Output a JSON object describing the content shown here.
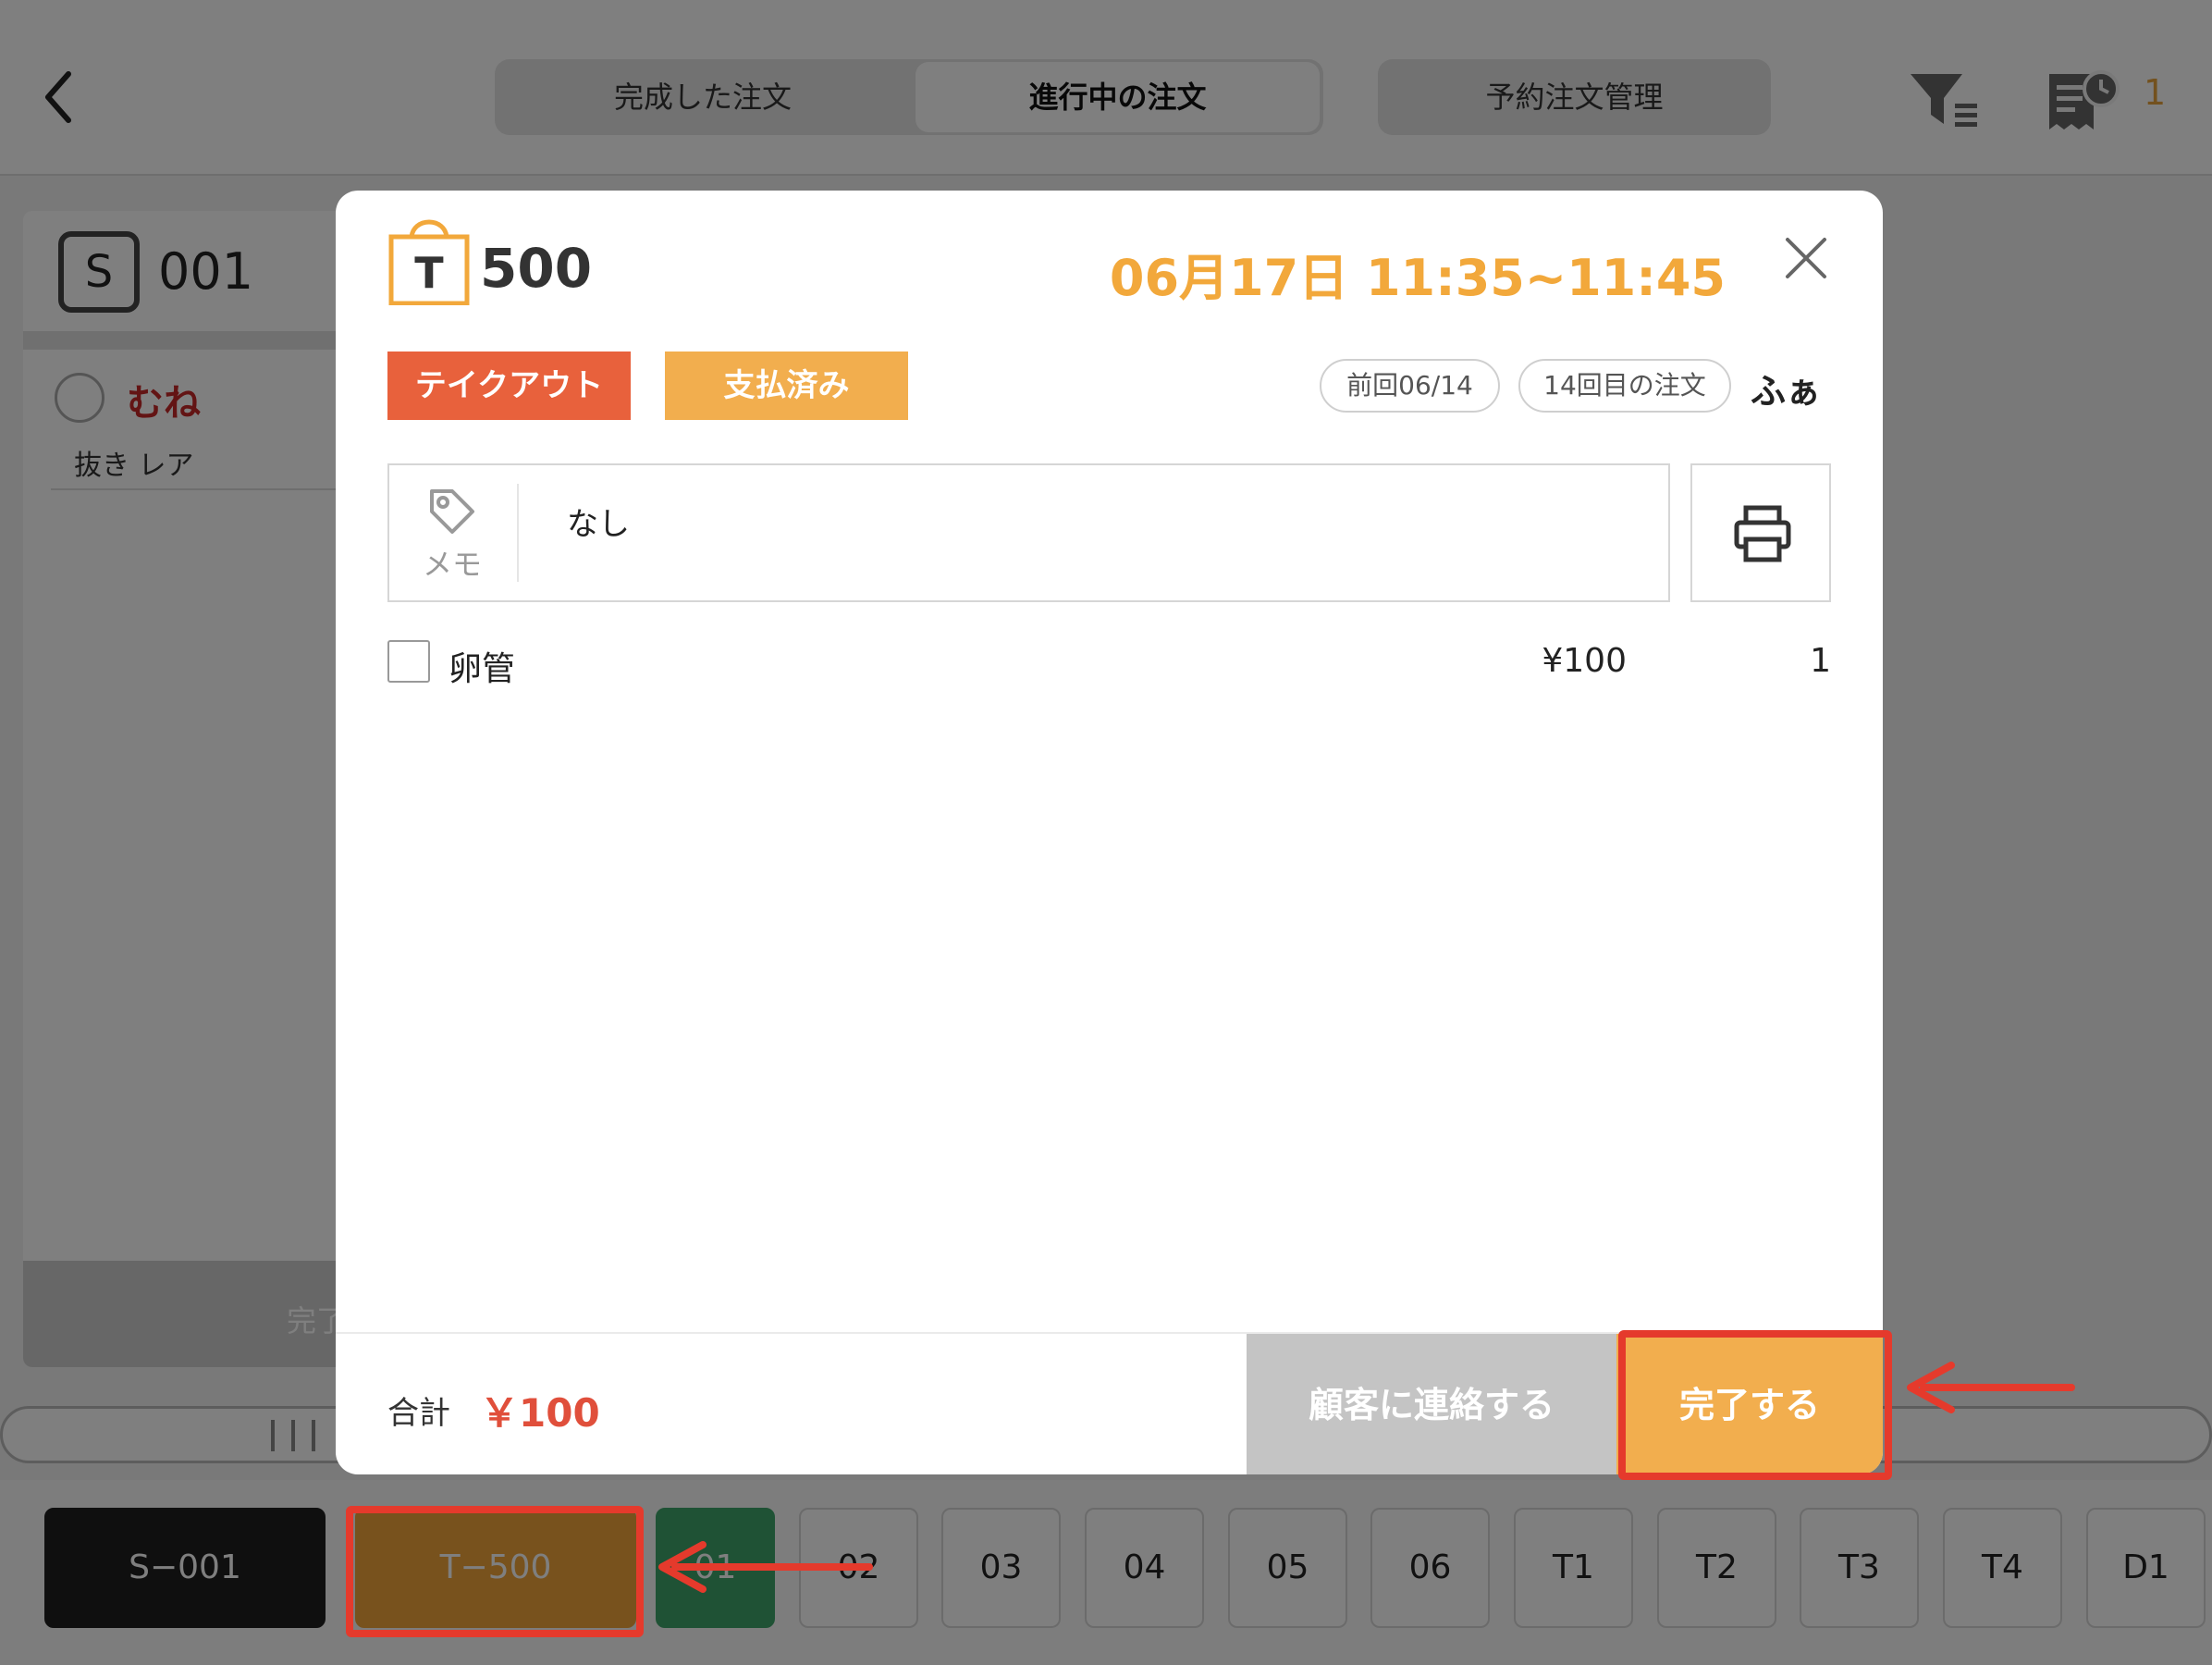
{
  "header": {
    "tabs": [
      {
        "label": "完成した注文"
      },
      {
        "label": "進行中の注文"
      }
    ],
    "reserve_label": "予約注文管理",
    "receipt_count": "1"
  },
  "background_card": {
    "badge": "S",
    "number": "001",
    "item_name": "むね",
    "item_sub": "抜き レア",
    "footer_label": "完了"
  },
  "tables": [
    {
      "label": "S−001",
      "state": "selected"
    },
    {
      "label": "T−500",
      "state": "takeout"
    },
    {
      "label": "01",
      "state": "occupied"
    },
    {
      "label": "02"
    },
    {
      "label": "03"
    },
    {
      "label": "04"
    },
    {
      "label": "05"
    },
    {
      "label": "06"
    },
    {
      "label": "T1"
    },
    {
      "label": "T2"
    },
    {
      "label": "T3"
    },
    {
      "label": "T4"
    },
    {
      "label": "D1"
    }
  ],
  "modal": {
    "bag_letter": "T",
    "order_number": "500",
    "time_range": "06月17日 11:35~11:45",
    "tag_takeout": "テイクアウト",
    "tag_paid": "支払済み",
    "last_visit": "前回06/14",
    "order_count": "14回目の注文",
    "customer_name": "ふぁ",
    "memo_label": "メモ",
    "memo_text": "なし",
    "items": [
      {
        "name": "卵管",
        "price": "¥100",
        "qty": "1"
      }
    ],
    "total_label": "合計",
    "total_value": "￥100",
    "contact_label": "顧客に連絡する",
    "complete_label": "完了する"
  },
  "colors": {
    "accent": "#f2ae4e",
    "takeout": "#e8613c",
    "total": "#e04f3b",
    "callout": "#e53a2c"
  }
}
